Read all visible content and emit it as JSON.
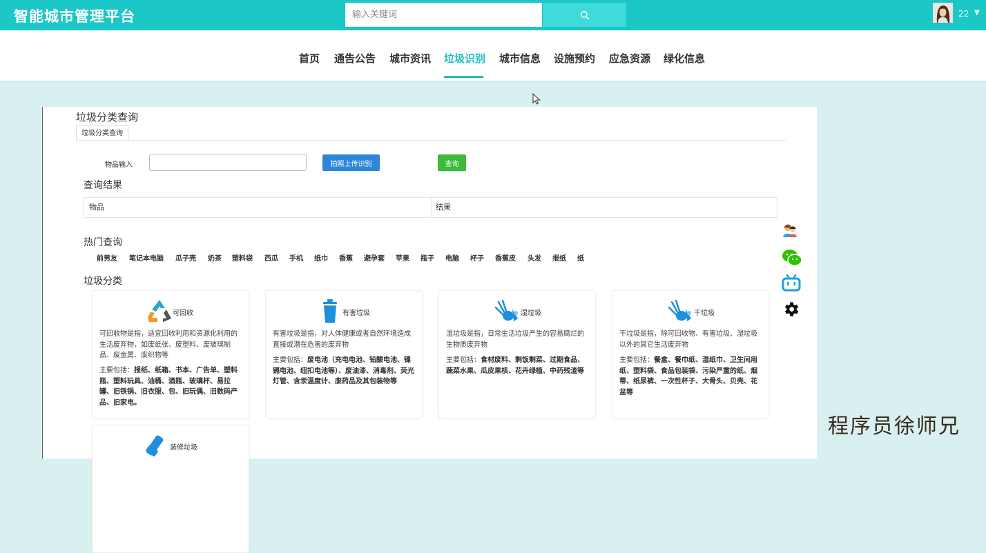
{
  "header": {
    "brand": "智能城市管理平台",
    "search_placeholder": "输入关键词",
    "search_icon": "search-icon",
    "username": "22",
    "dropdown_icon": "caret-down-icon"
  },
  "nav": {
    "items": [
      "首页",
      "通告公告",
      "城市资讯",
      "垃圾识别",
      "城市信息",
      "设施预约",
      "应急资源",
      "绿化信息"
    ],
    "active": "垃圾识别"
  },
  "page": {
    "title": "垃圾分类查询",
    "tab": "垃圾分类查询",
    "form": {
      "label": "物品输入",
      "input_value": "",
      "upload_button": "拍照上传识别",
      "query_button": "查询"
    },
    "results": {
      "heading": "查询结果",
      "columns": [
        "物品",
        "结果"
      ]
    },
    "hot": {
      "heading": "热门查询",
      "items": [
        "前男友",
        "笔记本电脑",
        "瓜子壳",
        "奶茶",
        "塑料袋",
        "西瓜",
        "手机",
        "纸巾",
        "香蕉",
        "避孕套",
        "苹果",
        "瓶子",
        "电脑",
        "杯子",
        "香蕉皮",
        "头发",
        "报纸",
        "纸"
      ]
    },
    "categories_heading": "垃圾分类",
    "categories": [
      {
        "name": "可回收",
        "icon": "recycle-icon",
        "desc": "可回收物是指，适宜回收利用和资源化利用的生活废弃物，如废纸张、废塑料、废玻璃制品、废金属、废织物等",
        "includes_label": "主要包括：",
        "includes": "报纸、纸箱、书本、广告单、塑料瓶、塑料玩具、油桶、酒瓶、玻璃杯、易拉罐、旧铁锅、旧衣服、包、旧玩偶、旧数码产品、旧家电。"
      },
      {
        "name": "有害垃圾",
        "icon": "trash-bin-icon",
        "desc": "有害垃圾是指，对人体健康或者自然环境造成直接或潜在危害的废弃物",
        "includes_label": "主要包括：",
        "includes": "废电池（充电电池、铅酸电池、镍镉电池、纽扣电池等）、废油漆、消毒剂、荧光灯管、含汞温度计、废药品及其包装物等"
      },
      {
        "name": "湿垃圾",
        "icon": "food-waste-icon",
        "desc": "湿垃圾是指，日常生活垃圾产生的容易腐烂的生物质废弃物",
        "includes_label": "主要包括：",
        "includes": "食材废料、剩饭剩菜、过期食品、蔬菜水果、瓜皮果核、花卉绿植、中药残渣等"
      },
      {
        "name": "干垃圾",
        "icon": "dry-waste-icon",
        "desc": "干垃圾是指，除可回收物、有害垃圾、湿垃圾以外的其它生活废弃物",
        "includes_label": "主要包括：",
        "includes": "餐盒、餐巾纸、湿纸巾、卫生间用纸、塑料袋、食品包装袋、污染严重的纸、烟蒂、纸尿裤、一次性杯子、大骨头、贝壳、花盆等"
      },
      {
        "name": "装修垃圾",
        "icon": "renovation-waste-icon"
      }
    ]
  },
  "side_toolbar": [
    "customer-service-icon",
    "wechat-icon",
    "bilibili-icon",
    "settings-gear-icon"
  ],
  "watermark": "程序员徐师兄",
  "colors": {
    "primary": "#1bc7c7",
    "active_nav": "#1bbfc4",
    "upload_button": "#2c86d9",
    "query_button": "#3bba3b",
    "page_bg": "#d9f0f0"
  }
}
